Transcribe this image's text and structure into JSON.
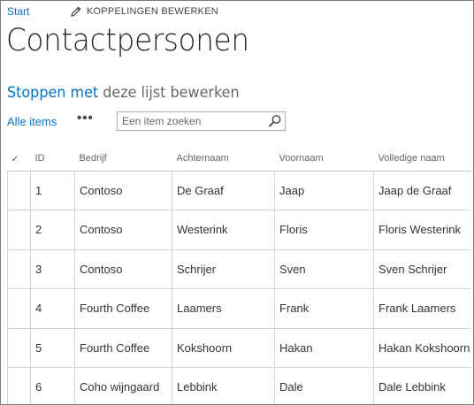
{
  "topbar": {
    "start_label": "Start",
    "edit_links_label": "KOPPELINGEN BEWERKEN"
  },
  "page": {
    "title": "Contactpersonen"
  },
  "stop_edit": {
    "link_label": "Stoppen met",
    "rest_label": " deze lijst bewerken"
  },
  "viewbar": {
    "all_items_label": "Alle items",
    "more_label": "•••",
    "search_placeholder": "Een item zoeken"
  },
  "icons": {
    "edit": "pencil-icon",
    "search": "search-icon",
    "select_all": "checkmark-icon"
  },
  "colors": {
    "link": "#0072c6",
    "text": "#333333",
    "border": "#d4d4d4"
  },
  "table": {
    "select_all_glyph": "✓",
    "headers": {
      "id": "ID",
      "company": "Bedrijf",
      "last_name": "Achternaam",
      "first_name": "Voornaam",
      "full_name": "Volledige naam"
    },
    "rows": [
      {
        "id": "1",
        "company": "Contoso",
        "last_name": "De Graaf",
        "first_name": "Jaap",
        "full_name": "Jaap de Graaf"
      },
      {
        "id": "2",
        "company": "Contoso",
        "last_name": "Westerink",
        "first_name": "Floris",
        "full_name": "Floris Westerink"
      },
      {
        "id": "3",
        "company": "Contoso",
        "last_name": "Schrijer",
        "first_name": "Sven",
        "full_name": "Sven Schrijer"
      },
      {
        "id": "4",
        "company": "Fourth Coffee",
        "last_name": "Laamers",
        "first_name": "Frank",
        "full_name": "Frank Laamers"
      },
      {
        "id": "5",
        "company": "Fourth Coffee",
        "last_name": "Kokshoorn",
        "first_name": "Hakan",
        "full_name": "Hakan Kokshoorn"
      },
      {
        "id": "6",
        "company": "Coho wijngaard",
        "last_name": "Lebbink",
        "first_name": "Dale",
        "full_name": "Dale Lebbink"
      }
    ]
  }
}
